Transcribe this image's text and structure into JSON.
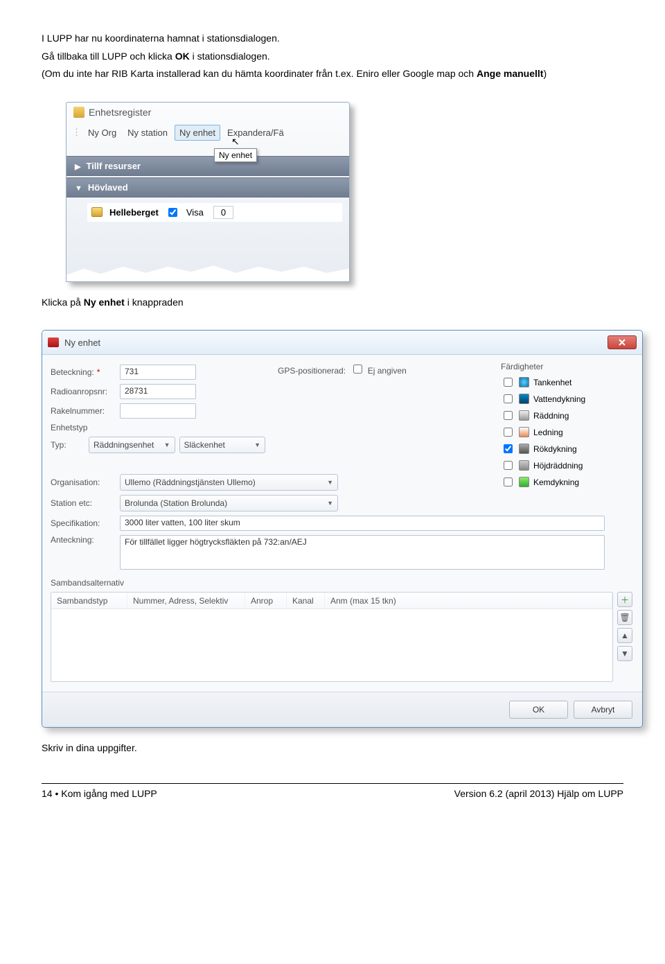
{
  "intro": {
    "p1": "I LUPP har nu koordinaterna hamnat i stationsdialogen.",
    "p2a": "Gå tillbaka till LUPP och klicka ",
    "p2b": "OK",
    "p2c": " i stationsdialogen.",
    "p3a": "(Om du inte har RIB Karta installerad kan du hämta koordinater från t.ex. Eniro eller Google map och ",
    "p3b": "Ange manuellt",
    "p3c": ")"
  },
  "shot1": {
    "window_title": "Enhetsregister",
    "toolbar": {
      "ny_org": "Ny Org",
      "ny_station": "Ny station",
      "ny_enhet": "Ny enhet",
      "expandera": "Expandera/Fä"
    },
    "tooltip": "Ny enhet",
    "bars": {
      "tillf": "Tillf resurser",
      "hovlaved": "Hövlaved"
    },
    "item": {
      "name": "Helleberget",
      "visa": "Visa",
      "count": "0"
    }
  },
  "mid_text": {
    "p1a": "Klicka på ",
    "p1b": "Ny enhet",
    "p1c": " i knappraden"
  },
  "dialog": {
    "title": "Ny enhet",
    "labels": {
      "beteckning": "Beteckning:",
      "radioanropsnr": "Radioanropsnr:",
      "rakelnummer": "Rakelnummer:",
      "enhetstyp": "Enhetstyp",
      "typ": "Typ:",
      "organisation": "Organisation:",
      "station_etc": "Station etc:",
      "specifikation": "Specifikation:",
      "anteckning": "Anteckning:",
      "gps": "GPS-positionerad:",
      "ej_angiven": "Ej angiven",
      "fardigheter": "Färdigheter",
      "samband": "Sambandsalternativ"
    },
    "required_mark": "*",
    "values": {
      "beteckning": "731",
      "radioanropsnr": "28731",
      "rakelnummer": "",
      "typ1": "Räddningsenhet",
      "typ2": "Släckenhet",
      "organisation": "Ullemo (Räddningstjänsten Ullemo)",
      "station": "Brolunda (Station Brolunda)",
      "specifikation": "3000 liter vatten, 100 liter skum",
      "anteckning": "För tillfället ligger högtrycksfläkten på 732:an/AEJ"
    },
    "skills": {
      "tankenhet": "Tankenhet",
      "vattendykning": "Vattendykning",
      "raddning": "Räddning",
      "ledning": "Ledning",
      "rokdykning": "Rökdykning",
      "hojdraddning": "Höjdräddning",
      "kemdykning": "Kemdykning"
    },
    "samband_cols": {
      "c1": "Sambandstyp",
      "c2": "Nummer, Adress, Selektiv",
      "c3": "Anrop",
      "c4": "Kanal",
      "c5": "Anm (max 15 tkn)"
    },
    "buttons": {
      "ok": "OK",
      "avbryt": "Avbryt"
    }
  },
  "outro": {
    "p1": "Skriv in dina uppgifter."
  },
  "footer": {
    "left": "14  •  Kom igång med LUPP",
    "right": "Version 6.2 (april 2013) Hjälp om LUPP"
  }
}
